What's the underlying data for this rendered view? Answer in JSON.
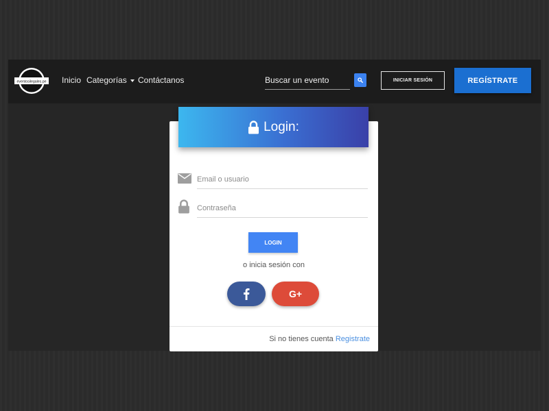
{
  "brand": {
    "logo_text": "eventosilegales.pe"
  },
  "nav": {
    "items": [
      {
        "label": "Inicio"
      },
      {
        "label": "Categorías"
      },
      {
        "label": "Contáctanos"
      }
    ],
    "search": {
      "placeholder": "Buscar un evento"
    },
    "login_label": "INICIAR SESIÓN",
    "register_label": "REGÍSTRATE"
  },
  "login": {
    "title": "Login:",
    "email_placeholder": "Email o usuario",
    "password_placeholder": "Contraseña",
    "submit_label": "LOGIN",
    "alt_text": "o inicia sesión con",
    "social": {
      "google_label": "G+"
    },
    "footer_text": "Si no tienes cuenta",
    "footer_link": "Registrate"
  },
  "colors": {
    "navbar": "#1c1c1c",
    "accent_blue": "#4285f4",
    "register_blue": "#1b6fd1",
    "facebook": "#3b5999",
    "google": "#dd4b39",
    "header_gradient_start": "#3cb7ef",
    "header_gradient_end": "#3a40a8"
  },
  "icons": [
    "search-icon",
    "lock-icon",
    "envelope-icon",
    "facebook-icon",
    "google-plus-icon",
    "caret-down-icon"
  ]
}
